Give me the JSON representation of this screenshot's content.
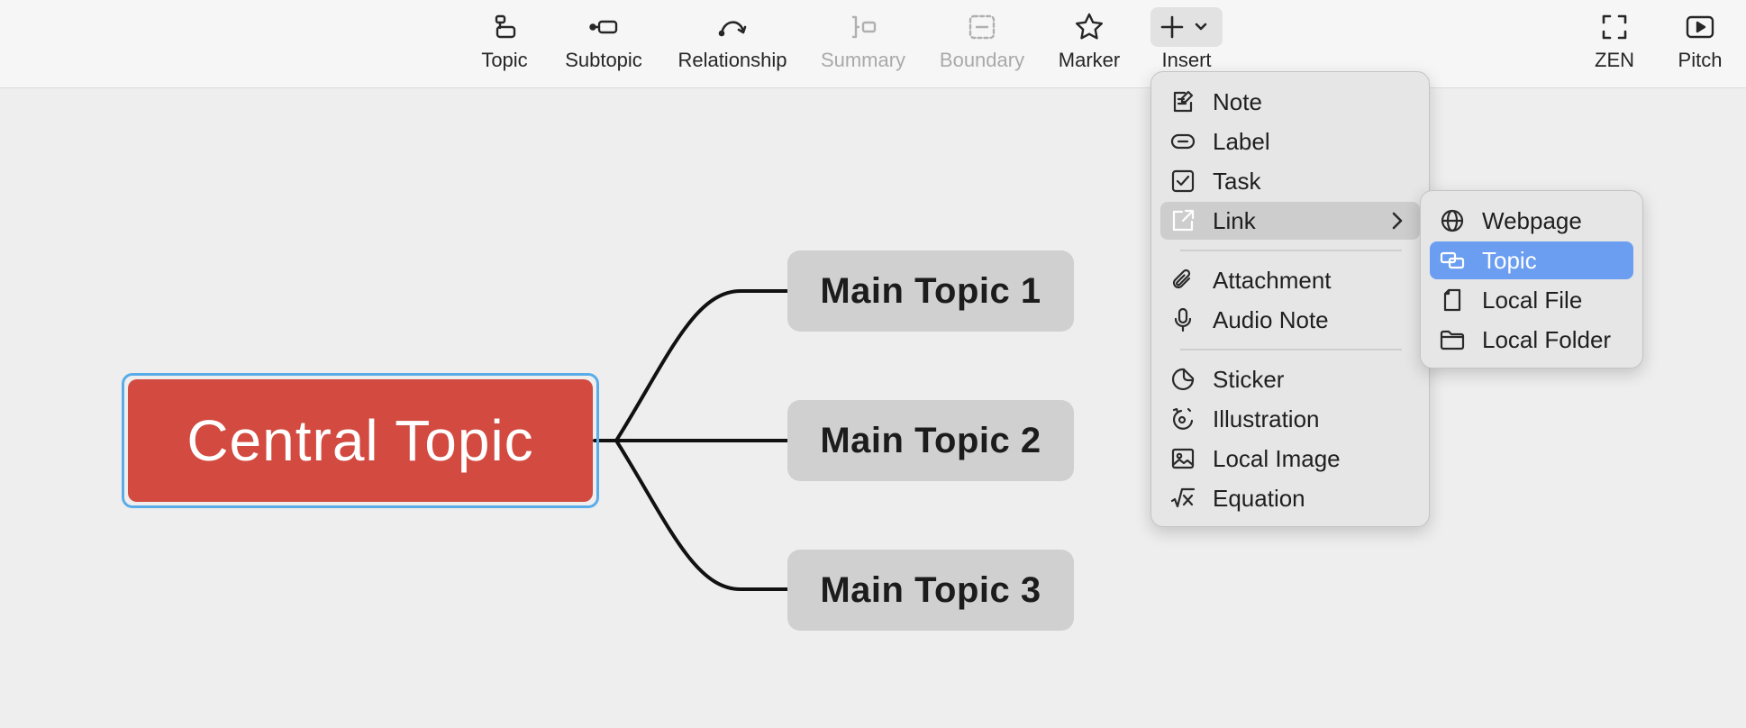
{
  "toolbar": {
    "topic": "Topic",
    "subtopic": "Subtopic",
    "relationship": "Relationship",
    "summary": "Summary",
    "boundary": "Boundary",
    "marker": "Marker",
    "insert": "Insert",
    "zen": "ZEN",
    "pitch": "Pitch"
  },
  "canvas": {
    "central_topic": "Central Topic",
    "main_topics": [
      "Main Topic 1",
      "Main Topic 2",
      "Main Topic 3"
    ]
  },
  "insert_menu": {
    "items": [
      {
        "label": "Note",
        "icon": "note-icon"
      },
      {
        "label": "Label",
        "icon": "label-icon"
      },
      {
        "label": "Task",
        "icon": "task-icon"
      },
      {
        "label": "Link",
        "icon": "link-icon"
      },
      {
        "label": "Attachment",
        "icon": "attachment-icon"
      },
      {
        "label": "Audio Note",
        "icon": "microphone-icon"
      },
      {
        "label": "Sticker",
        "icon": "sticker-icon"
      },
      {
        "label": "Illustration",
        "icon": "illustration-icon"
      },
      {
        "label": "Local Image",
        "icon": "image-icon"
      },
      {
        "label": "Equation",
        "icon": "equation-icon"
      }
    ]
  },
  "link_submenu": {
    "items": [
      {
        "label": "Webpage",
        "icon": "globe-icon"
      },
      {
        "label": "Topic",
        "icon": "topic-link-icon"
      },
      {
        "label": "Local File",
        "icon": "file-icon"
      },
      {
        "label": "Local Folder",
        "icon": "folder-icon"
      }
    ]
  },
  "colors": {
    "central_fill": "#d24a40",
    "selection_border": "#5aace9",
    "main_topic_fill": "#d0d0d0",
    "menu_highlight": "#6b9ef0"
  }
}
